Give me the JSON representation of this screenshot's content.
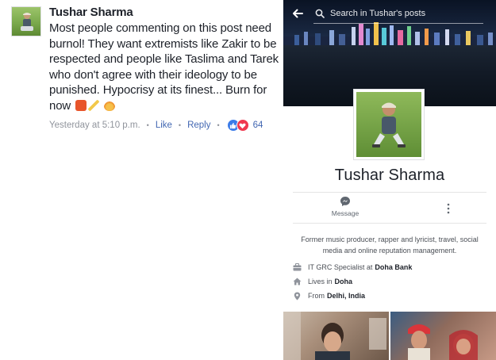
{
  "comment": {
    "author": "Tushar Sharma",
    "text": "Most people commenting on this post need burnol! They want extremists like Zakir to be respected and people like Taslima and Tarek who don't agree with their ideology to be punished. Hypocrisy at its finest... Burn for now",
    "emojis": [
      "fire-box-emoji",
      "pen-emoji",
      "fire-emoji"
    ],
    "timestamp": "Yesterday at 5:10 p.m.",
    "like_label": "Like",
    "reply_label": "Reply",
    "reaction_count": "64",
    "colors": {
      "link": "#4267b2",
      "meta": "#90949c",
      "like": "#3b7be8",
      "love": "#f0384f"
    }
  },
  "profile": {
    "search_placeholder": "Search in Tushar's posts",
    "name": "Tushar Sharma",
    "message_label": "Message",
    "bio": "Former music producer, rapper and lyricist, travel, social media and online reputation management.",
    "info": [
      {
        "icon": "briefcase-icon",
        "prefix": "IT GRC Specialist at",
        "value": "Doha Bank"
      },
      {
        "icon": "home-icon",
        "prefix": "Lives in",
        "value": "Doha"
      },
      {
        "icon": "location-pin-icon",
        "prefix": "From",
        "value": "Delhi, India"
      }
    ]
  }
}
